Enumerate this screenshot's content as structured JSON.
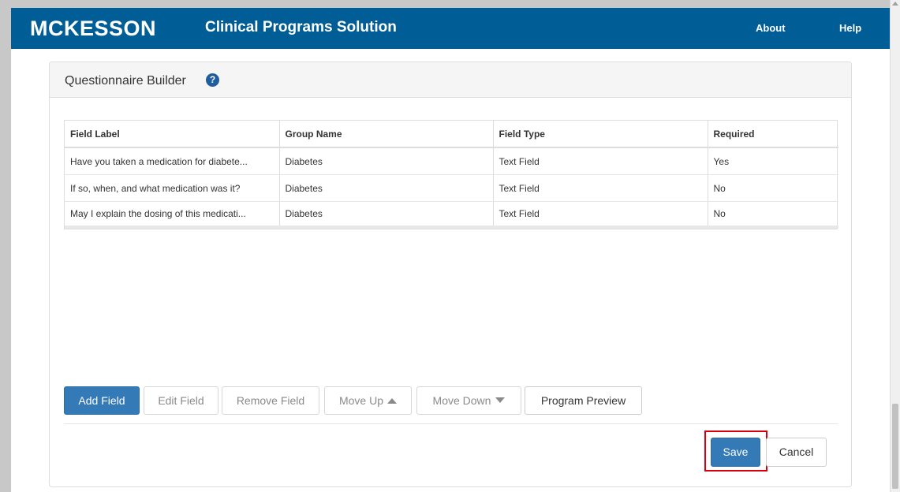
{
  "header": {
    "logo": "MCKESSON",
    "app_title": "Clinical Programs Solution",
    "nav": {
      "about": "About",
      "help": "Help"
    }
  },
  "panel": {
    "title": "Questionnaire Builder",
    "help_icon": "question-circle-icon",
    "help_glyph": "?"
  },
  "table": {
    "columns": [
      "Field Label",
      "Group Name",
      "Field Type",
      "Required"
    ],
    "rows": [
      [
        "Have you taken a medication for diabete...",
        "Diabetes",
        "Text Field",
        "Yes"
      ],
      [
        "If so, when, and what medication was it?",
        "Diabetes",
        "Text Field",
        "No"
      ],
      [
        "May I explain the dosing of this medicati...",
        "Diabetes",
        "Text Field",
        "No"
      ]
    ]
  },
  "toolbar": {
    "add_field": "Add Field",
    "edit_field": "Edit Field",
    "remove_field": "Remove Field",
    "move_up": "Move Up",
    "move_down": "Move Down",
    "program_preview": "Program Preview"
  },
  "footer": {
    "save": "Save",
    "cancel": "Cancel"
  },
  "colors": {
    "header_bg": "#005d96",
    "primary_button": "#337ab7",
    "highlight": "#d8000c"
  }
}
